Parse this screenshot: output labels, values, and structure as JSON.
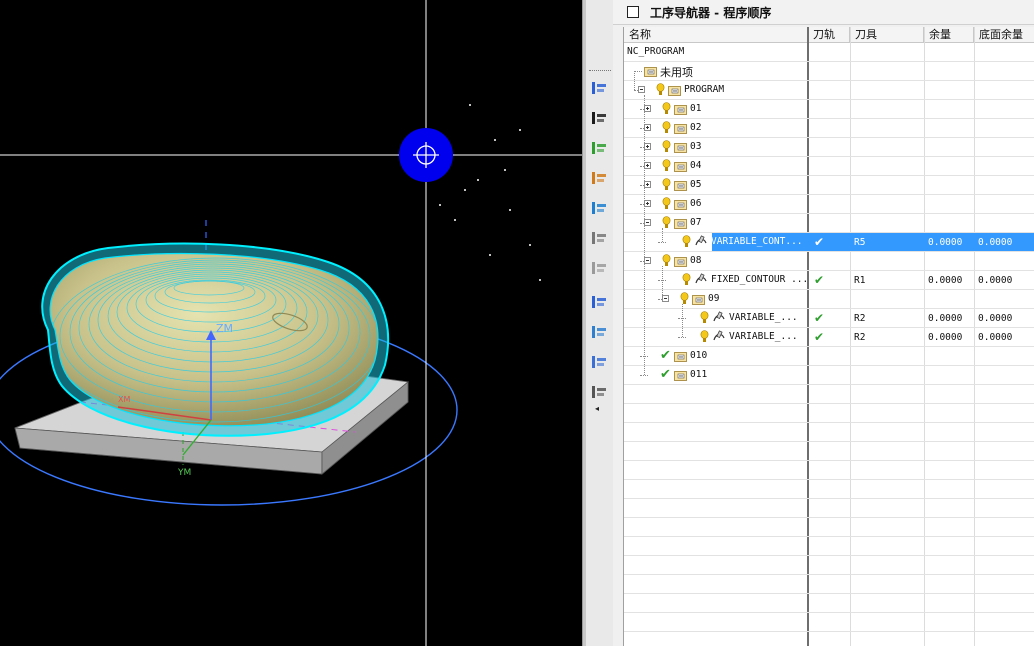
{
  "navigator": {
    "title": "工序导航器 - 程序顺序",
    "columns": [
      "名称",
      "刀轨",
      "刀具",
      "余量",
      "底面余量"
    ],
    "rows": [
      {
        "name": "NC_PROGRAM",
        "level": 0,
        "type": "root"
      },
      {
        "name": "未用项",
        "level": 1,
        "type": "folder"
      },
      {
        "name": "PROGRAM",
        "level": 1,
        "type": "group",
        "expanded": true
      },
      {
        "name": "01",
        "level": 2,
        "type": "group",
        "expanded": false
      },
      {
        "name": "02",
        "level": 2,
        "type": "group",
        "expanded": false
      },
      {
        "name": "03",
        "level": 2,
        "type": "group",
        "expanded": false
      },
      {
        "name": "04",
        "level": 2,
        "type": "group",
        "expanded": false
      },
      {
        "name": "05",
        "level": 2,
        "type": "group",
        "expanded": false
      },
      {
        "name": "06",
        "level": 2,
        "type": "group",
        "expanded": false
      },
      {
        "name": "07",
        "level": 2,
        "type": "group",
        "expanded": true
      },
      {
        "name": "VARIABLE_CONT...",
        "level": 3,
        "type": "operation",
        "path": "✔",
        "tool": "R5",
        "stock": "0.0000",
        "floor": "0.0000",
        "selected": true
      },
      {
        "name": "08",
        "level": 2,
        "type": "group",
        "expanded": true
      },
      {
        "name": "FIXED_CONTOUR ...",
        "level": 3,
        "type": "operation",
        "path": "✔",
        "tool": "R1",
        "stock": "0.0000",
        "floor": "0.0000"
      },
      {
        "name": "09",
        "level": 3,
        "type": "group",
        "expanded": true
      },
      {
        "name": "VARIABLE_...",
        "level": 4,
        "type": "operation",
        "path": "✔",
        "tool": "R2",
        "stock": "0.0000",
        "floor": "0.0000"
      },
      {
        "name": "VARIABLE_...",
        "level": 4,
        "type": "operation",
        "path": "✔",
        "tool": "R2",
        "stock": "0.0000",
        "floor": "0.0000"
      },
      {
        "name": "010",
        "level": 2,
        "type": "group-done"
      },
      {
        "name": "011",
        "level": 2,
        "type": "group-done"
      }
    ]
  },
  "viewport": {
    "axis_z_label": "ZM",
    "axis_y_label": "YM",
    "axis_x_label": "XM"
  },
  "colors": {
    "selection": "#3399ff",
    "toolpath": "#00e5ff",
    "part": "#c9c58a",
    "check": "#2e9e2e",
    "cursor": "#0000ee"
  },
  "resource_bar_icons": [
    "operation-navigator-icon",
    "program-icon",
    "verify-icon",
    "postprocess-icon",
    "toolpath-check-icon",
    "tool-list-icon",
    "tool-group-icon",
    "machine-icon",
    "simulate-icon",
    "shop-doc-icon",
    "report-icon",
    "history-icon"
  ]
}
